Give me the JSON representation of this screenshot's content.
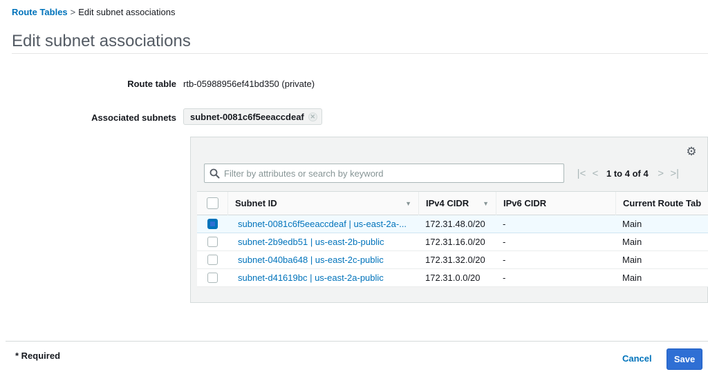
{
  "breadcrumb": {
    "parent": "Route Tables",
    "separator": ">",
    "current": "Edit subnet associations"
  },
  "page": {
    "title": "Edit subnet associations"
  },
  "form": {
    "route_table_label": "Route table",
    "route_table_value": "rtb-05988956ef41bd350 (private)",
    "associated_subnets_label": "Associated subnets",
    "associated_tokens": [
      "subnet-0081c6f5eeaccdeaf"
    ]
  },
  "table": {
    "filter_placeholder": "Filter by attributes or search by keyword",
    "pagination": "1 to 4 of 4",
    "columns": [
      "Subnet ID",
      "IPv4 CIDR",
      "IPv6 CIDR",
      "Current Route Tab"
    ],
    "rows": [
      {
        "subnet": "subnet-0081c6f5eeaccdeaf | us-east-2a-...",
        "ipv4": "172.31.48.0/20",
        "ipv6": "-",
        "route_table": "Main",
        "selected": true
      },
      {
        "subnet": "subnet-2b9edb51 | us-east-2b-public",
        "ipv4": "172.31.16.0/20",
        "ipv6": "-",
        "route_table": "Main",
        "selected": false
      },
      {
        "subnet": "subnet-040ba648 | us-east-2c-public",
        "ipv4": "172.31.32.0/20",
        "ipv6": "-",
        "route_table": "Main",
        "selected": false
      },
      {
        "subnet": "subnet-d41619bc | us-east-2a-public",
        "ipv4": "172.31.0.0/20",
        "ipv6": "-",
        "route_table": "Main",
        "selected": false
      }
    ]
  },
  "footer": {
    "required_note": "* Required",
    "cancel_label": "Cancel",
    "save_label": "Save"
  },
  "colors": {
    "link": "#0073bb",
    "primary_button": "#2f6fd4",
    "selected_row": "#f1faff"
  },
  "icons": {
    "search": "search-icon",
    "settings": "gear-icon",
    "remove_token": "close-icon",
    "first_page": "first-page-icon",
    "prev_page": "chevron-left-icon",
    "next_page": "chevron-right-icon",
    "last_page": "last-page-icon"
  }
}
